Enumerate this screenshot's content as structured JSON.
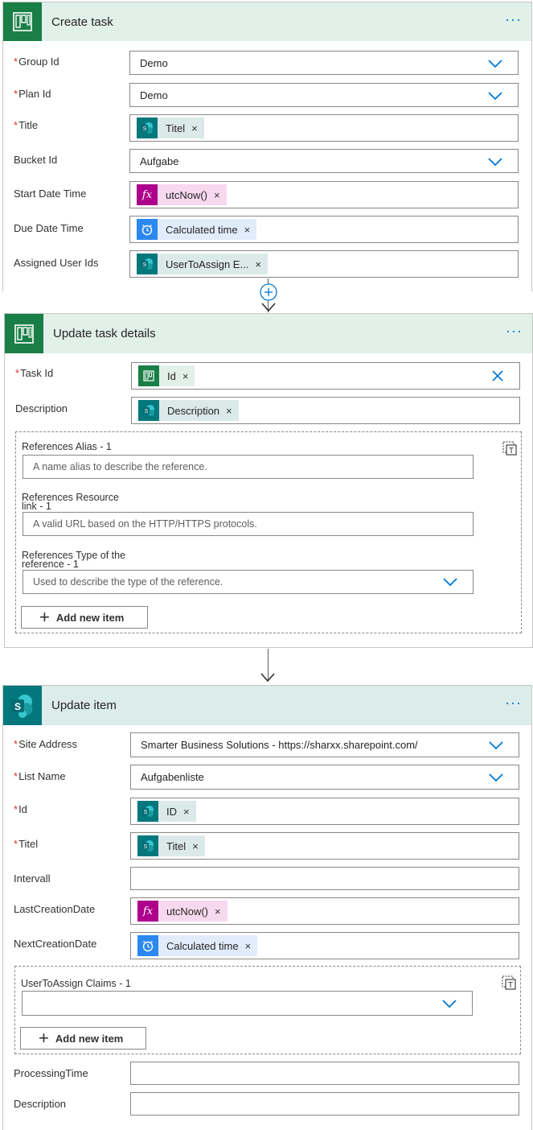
{
  "create_task": {
    "title": "Create task",
    "more": "···",
    "group_id": {
      "label": "Group Id",
      "value": "Demo"
    },
    "plan_id": {
      "label": "Plan Id",
      "value": "Demo"
    },
    "title_field": {
      "label": "Title",
      "token": "Titel"
    },
    "bucket_id": {
      "label": "Bucket Id",
      "value": "Aufgabe"
    },
    "start_date_time": {
      "label": "Start Date Time",
      "token": "utcNow()"
    },
    "due_date_time": {
      "label": "Due Date Time",
      "token": "Calculated time"
    },
    "assigned_user_ids": {
      "label": "Assigned User Ids",
      "token": "UserToAssign E..."
    }
  },
  "update_task_details": {
    "title": "Update task details",
    "more": "···",
    "task_id": {
      "label": "Task Id",
      "token": "Id"
    },
    "description": {
      "label": "Description",
      "token": "Description"
    },
    "references": {
      "alias_label": "References Alias - 1",
      "alias_placeholder": "A name alias to describe the reference.",
      "resource_label_1": "References Resource",
      "resource_label_2": "link - 1",
      "resource_placeholder": "A valid URL based on the HTTP/HTTPS protocols.",
      "type_label_1": "References Type of the",
      "type_label_2": "reference - 1",
      "type_placeholder": "Used to describe the type of the reference.",
      "add_item": "Add new item"
    }
  },
  "update_item": {
    "title": "Update item",
    "more": "···",
    "site_address": {
      "label": "Site Address",
      "value": "Smarter Business Solutions - https://sharxx.sharepoint.com/"
    },
    "list_name": {
      "label": "List Name",
      "value": "Aufgabenliste"
    },
    "id": {
      "label": "Id",
      "token": "ID"
    },
    "titel": {
      "label": "Titel",
      "token": "Titel"
    },
    "intervall": {
      "label": "Intervall",
      "value": ""
    },
    "last_creation_date": {
      "label": "LastCreationDate",
      "token": "utcNow()"
    },
    "next_creation_date": {
      "label": "NextCreationDate",
      "token": "Calculated time"
    },
    "user_to_assign_claims": {
      "label": "UserToAssign Claims - 1",
      "add_item": "Add new item"
    },
    "processing_time": {
      "label": "ProcessingTime",
      "value": ""
    },
    "description": {
      "label": "Description",
      "value": ""
    }
  },
  "icons": {
    "fx": "fx",
    "sp_letter": "S"
  },
  "colors": {
    "accent": "#0078d4",
    "planner": "#1a7f47",
    "sharepoint": "#03787c",
    "expression": "#ad008c",
    "schedule": "#2b88f0",
    "required": "#d13438"
  }
}
